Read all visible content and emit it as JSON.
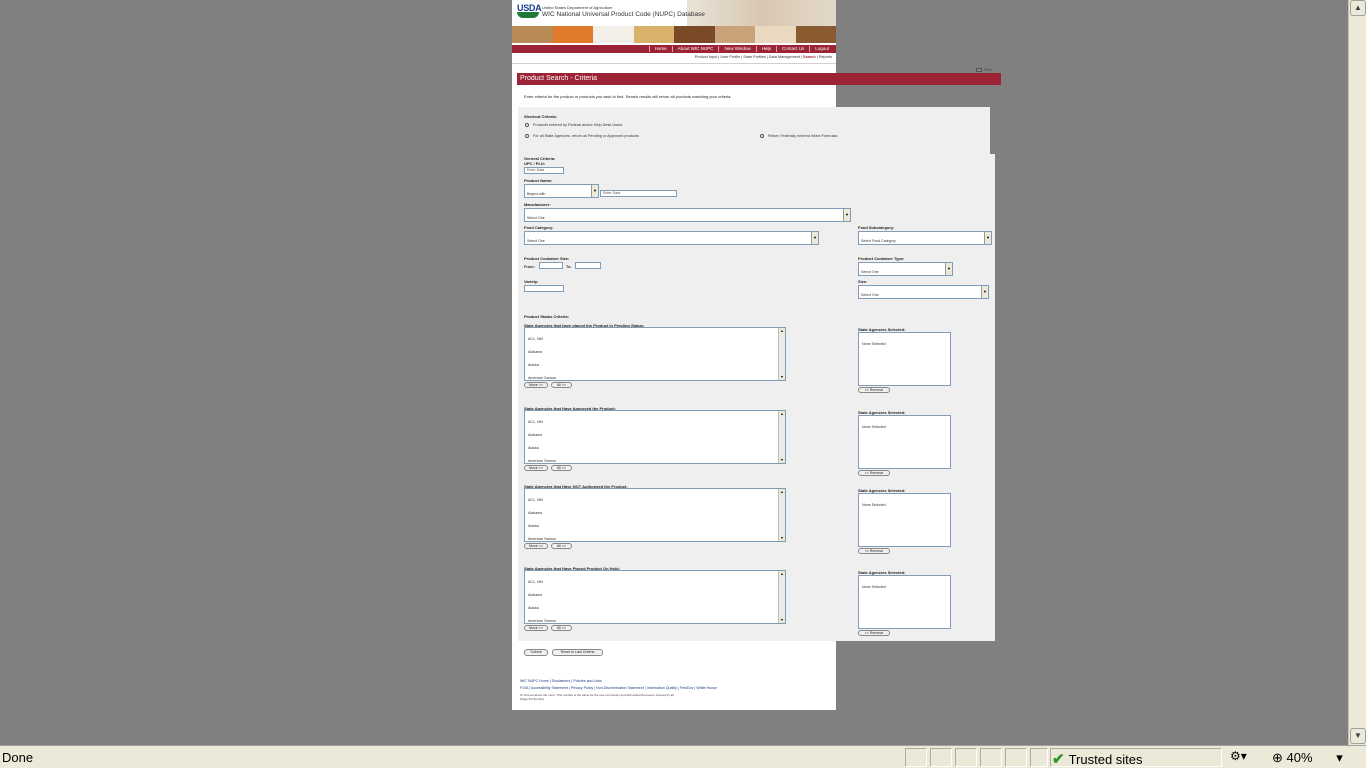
{
  "header": {
    "logo": "USDA",
    "department": "United States Department of Agriculture",
    "db_name": "WIC National Universal Product Code (NUPC) Database"
  },
  "nav": {
    "items": [
      "Home",
      "About WIC NUPC",
      "New Window",
      "Help",
      "Contact Us",
      "Logout"
    ]
  },
  "subnav": {
    "items": [
      "Product Input",
      "User Profile",
      "State Profiles",
      "Data Management",
      "Search",
      "Reports"
    ],
    "active": "Search"
  },
  "print_label": "Print",
  "page_title": "Product Search - Criteria",
  "instructions": "Enter criteria for the product or products you wish to find. Search results will return all products matching your criteria.",
  "shortcut": {
    "label": "Shortcut Criteria:",
    "options": [
      "Products entered by Federal and/or Help Desk Users",
      "For all State Agencies, return all Pending or Approved products",
      "Return Federally entered Infant Formulas"
    ]
  },
  "general": {
    "label": "General Criteria:",
    "upc_label": "UPC / PLU:",
    "upc_placeholder": "Enter Data",
    "product_name_label": "Product Name:",
    "product_name_mode": "Begins with",
    "product_name_placeholder": "Enter Data",
    "manufacturer_label": "Manufacturer:",
    "manufacturer_value": "Select One",
    "food_category_label": "Food Category:",
    "food_category_value": "Select One",
    "food_subcategory_label": "Food Subcategory:",
    "food_subcategory_value": "Select Food Category",
    "container_size_label": "Product Container Size:",
    "from_label": "From:",
    "to_label": "To:",
    "container_type_label": "Product Container Type:",
    "container_type_value": "Select One",
    "variety_label": "Variety:",
    "size_label": "Size:",
    "size_value": "Select One"
  },
  "status": {
    "label": "Product Status Criteria:",
    "selected_label": "State Agencies Selected:",
    "none_selected": "None Selected",
    "move_label": "Move >>",
    "all_label": "All >>",
    "remove_label": "<< Remove",
    "agencies": [
      "ACL, NM",
      "Alabama",
      "Alaska",
      "American Samoa"
    ],
    "groups": [
      "State Agencies that have placed the Product in Pending Status:",
      "State Agencies that Have Approved the Product:",
      "State Agencies that Have NOT Authorized the Product:",
      "State Agencies that Have Placed Product On Hold:"
    ]
  },
  "actions": {
    "submit": "Submit",
    "reset": "Reset to Last Criteria"
  },
  "footer": {
    "links1": "WIC NUPC Home | Disclaimers | Policies and Links",
    "links2": "FOIA | Accessibility Statement | Privacy Policy | Non-Discrimination Statement | Information Quality | FirstGov | White House",
    "note1": "To find out about the more. This number is the same for the use community and with authorized users.  Access by all.",
    "note2": "[Page ID Number]"
  },
  "statusbar": {
    "status": "Done",
    "zone": "Trusted sites",
    "zoom": "40%"
  }
}
